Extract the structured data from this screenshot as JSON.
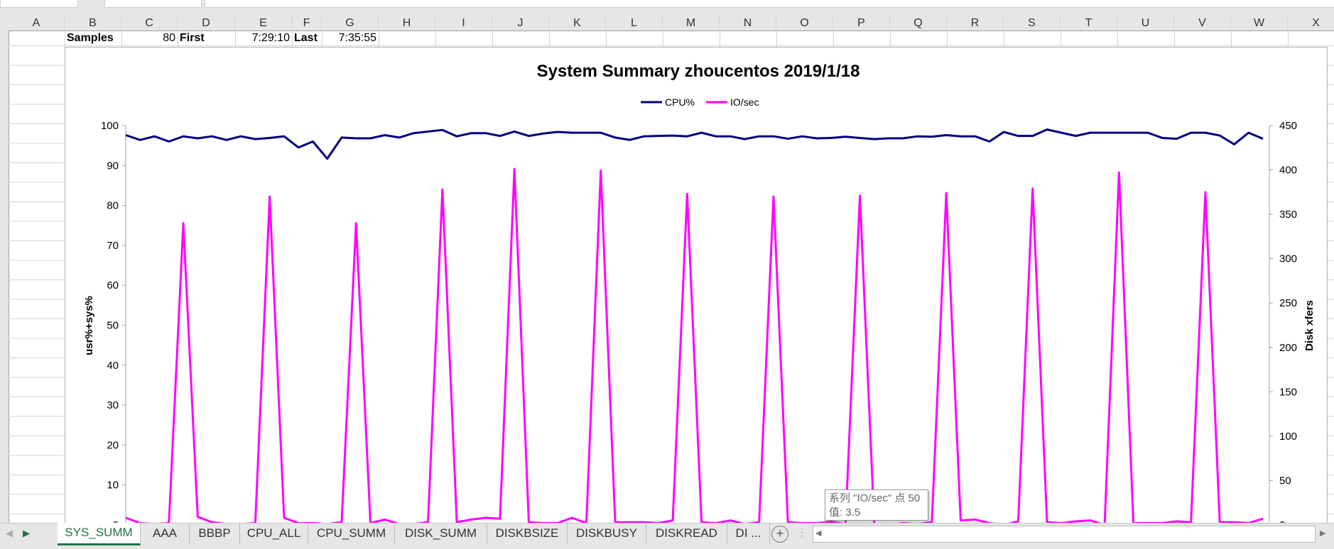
{
  "columns": [
    "A",
    "B",
    "C",
    "D",
    "E",
    "F",
    "G",
    "H",
    "I",
    "J",
    "K",
    "L",
    "M",
    "N",
    "O",
    "P",
    "Q",
    "R",
    "S",
    "T",
    "U",
    "V",
    "W",
    "X"
  ],
  "summary_row": {
    "samples_label": "Samples",
    "samples_value": "80",
    "first_label": "First",
    "first_value": "7:29:10",
    "last_label": "Last",
    "last_value": "7:35:55"
  },
  "tabs": [
    "SYS_SUMM",
    "AAA",
    "BBBP",
    "CPU_ALL",
    "CPU_SUMM",
    "DISK_SUMM",
    "DISKBSIZE",
    "DISKBUSY",
    "DISKREAD",
    "DI ..."
  ],
  "active_tab": "SYS_SUMM",
  "tooltip": {
    "line1": "系列 \"IO/sec\" 点 50",
    "line2": "值: 3.5"
  },
  "chart_data": {
    "type": "line",
    "title": "System Summary zhoucentos  2019/1/18",
    "ylabel": "usr%+sys%",
    "y2label": "Disk xfers",
    "ylim": [
      0,
      100
    ],
    "y2lim": [
      0,
      450
    ],
    "yticks": [
      0,
      10,
      20,
      30,
      40,
      50,
      60,
      70,
      80,
      90,
      100
    ],
    "y2ticks": [
      0,
      50,
      100,
      150,
      200,
      250,
      300,
      350,
      400,
      450
    ],
    "legend": "top",
    "grid": false,
    "series": [
      {
        "name": "CPU%",
        "axis": "left",
        "color": "#000080",
        "values": [
          97.6,
          96.4,
          97.3,
          96.0,
          97.3,
          96.8,
          97.3,
          96.4,
          97.3,
          96.6,
          96.9,
          97.3,
          94.5,
          96.0,
          91.7,
          97.0,
          96.8,
          96.8,
          97.6,
          97.0,
          98.1,
          98.5,
          98.9,
          97.3,
          98.1,
          98.1,
          97.4,
          98.5,
          97.4,
          98.0,
          98.4,
          98.2,
          98.2,
          98.2,
          97.0,
          96.4,
          97.3,
          97.4,
          97.5,
          97.3,
          98.2,
          97.3,
          97.3,
          96.6,
          97.3,
          97.3,
          96.7,
          97.3,
          96.8,
          96.9,
          97.2,
          96.9,
          96.6,
          96.8,
          96.8,
          97.3,
          97.2,
          97.6,
          97.3,
          97.3,
          96.0,
          98.4,
          97.4,
          97.4,
          99.0,
          98.2,
          97.4,
          98.2,
          98.2,
          98.2,
          98.2,
          98.2,
          96.9,
          96.7,
          98.2,
          98.2,
          97.5,
          95.3,
          98.2,
          96.7
        ]
      },
      {
        "name": "IO/sec",
        "axis": "right",
        "color": "#ff00ff",
        "values": [
          8,
          2,
          1,
          2,
          340,
          9,
          3,
          1,
          1,
          2,
          370,
          8,
          2,
          2,
          1,
          3,
          340,
          2,
          6,
          1,
          1,
          3,
          378,
          3,
          6,
          8,
          7,
          401,
          3,
          2,
          2,
          8,
          2,
          399,
          3,
          3,
          3,
          2,
          5,
          373,
          3,
          2,
          5,
          1,
          3,
          370,
          3,
          2,
          2,
          3.5,
          1,
          371,
          1,
          0,
          2,
          1,
          3,
          374,
          5,
          6,
          2,
          0,
          4,
          379,
          3,
          2,
          4,
          5,
          0,
          397,
          2,
          2,
          2,
          4,
          3,
          375,
          3,
          3,
          2,
          7
        ]
      }
    ]
  }
}
